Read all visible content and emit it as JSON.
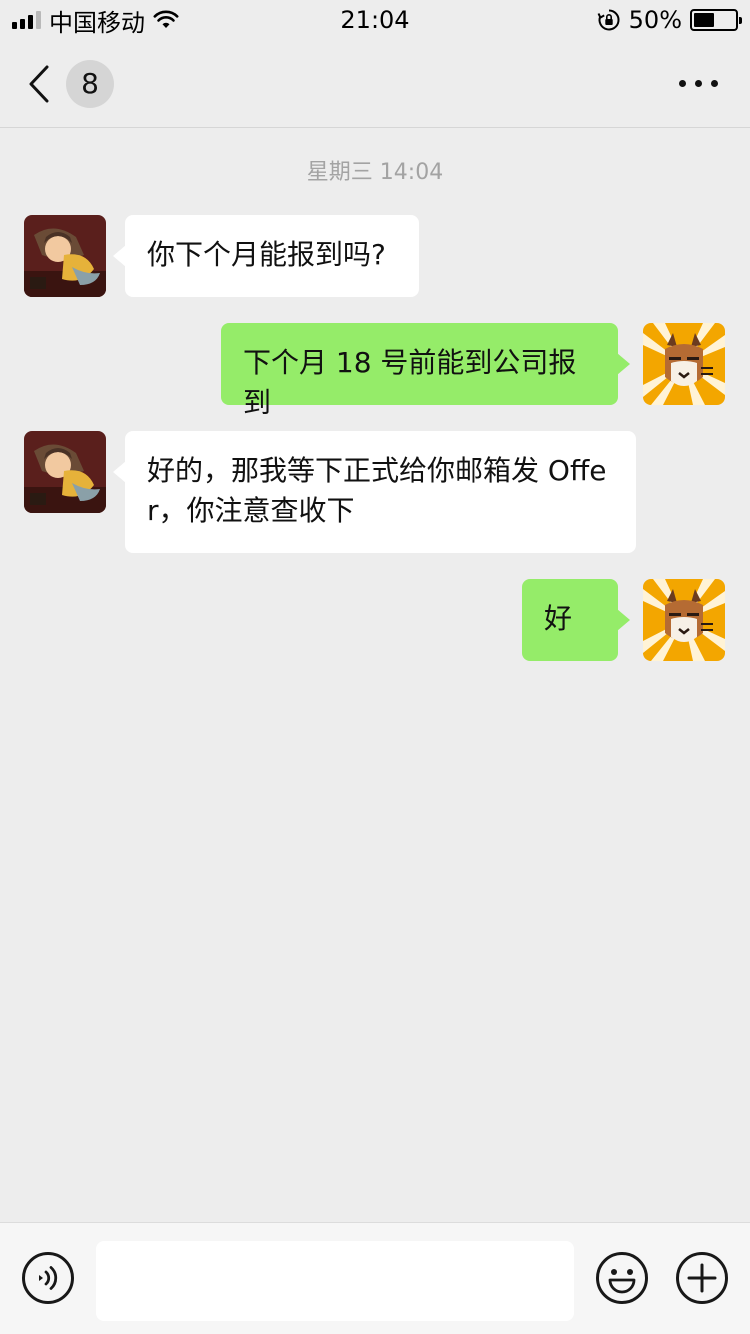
{
  "status_bar": {
    "carrier": "中国移动",
    "time": "21:04",
    "battery": "50%",
    "battery_level": 0.5
  },
  "nav": {
    "unread_count": "8",
    "back_icon": "chevron-left-icon",
    "more_icon": "ellipsis-icon"
  },
  "chat": {
    "timestamp": "星期三 14:04",
    "messages": [
      {
        "side": "left",
        "text": "你下个月能报到吗?"
      },
      {
        "side": "right",
        "text": "下个月 18 号前能到公司报到"
      },
      {
        "side": "left",
        "text": "好的，那我等下正式给你邮箱发 Offe r，你注意查收下"
      },
      {
        "side": "right",
        "text": "好"
      }
    ]
  },
  "input_bar": {
    "voice_icon": "voice-icon",
    "emoji_icon": "emoji-icon",
    "plus_icon": "plus-icon",
    "input_value": ""
  },
  "colors": {
    "background": "#ededed",
    "bubble_sent": "#95ec69",
    "bubble_received": "#ffffff"
  }
}
